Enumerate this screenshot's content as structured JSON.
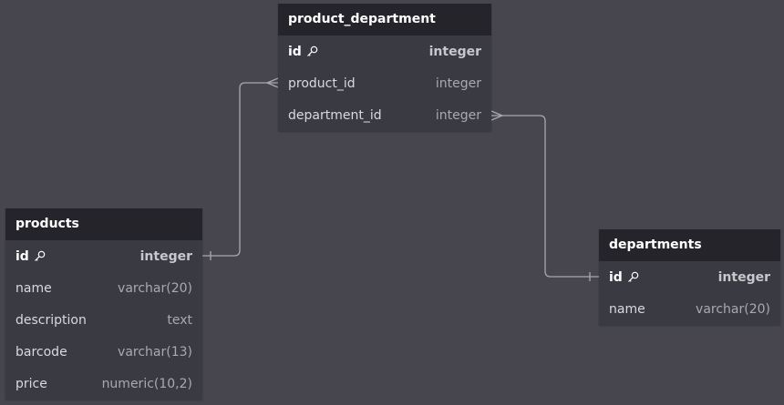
{
  "diagram": {
    "tables": {
      "product_department": {
        "name": "product_department",
        "columns": [
          {
            "name": "id",
            "type": "integer",
            "primary_key": true
          },
          {
            "name": "product_id",
            "type": "integer"
          },
          {
            "name": "department_id",
            "type": "integer"
          }
        ]
      },
      "products": {
        "name": "products",
        "columns": [
          {
            "name": "id",
            "type": "integer",
            "primary_key": true
          },
          {
            "name": "name",
            "type": "varchar(20)"
          },
          {
            "name": "description",
            "type": "text"
          },
          {
            "name": "barcode",
            "type": "varchar(13)"
          },
          {
            "name": "price",
            "type": "numeric(10,2)"
          }
        ]
      },
      "departments": {
        "name": "departments",
        "columns": [
          {
            "name": "id",
            "type": "integer",
            "primary_key": true
          },
          {
            "name": "name",
            "type": "varchar(20)"
          }
        ]
      }
    },
    "relationships": [
      {
        "from": "products.id",
        "to": "product_department.product_id",
        "from_cardinality": "one",
        "to_cardinality": "many"
      },
      {
        "from": "departments.id",
        "to": "product_department.department_id",
        "from_cardinality": "one",
        "to_cardinality": "many"
      }
    ],
    "colors": {
      "background": "#47464f",
      "table_body": "#3a3a42",
      "table_header": "#24242a",
      "connector": "#a8a8ae"
    },
    "icons": {
      "primary_key": "key-icon"
    }
  }
}
